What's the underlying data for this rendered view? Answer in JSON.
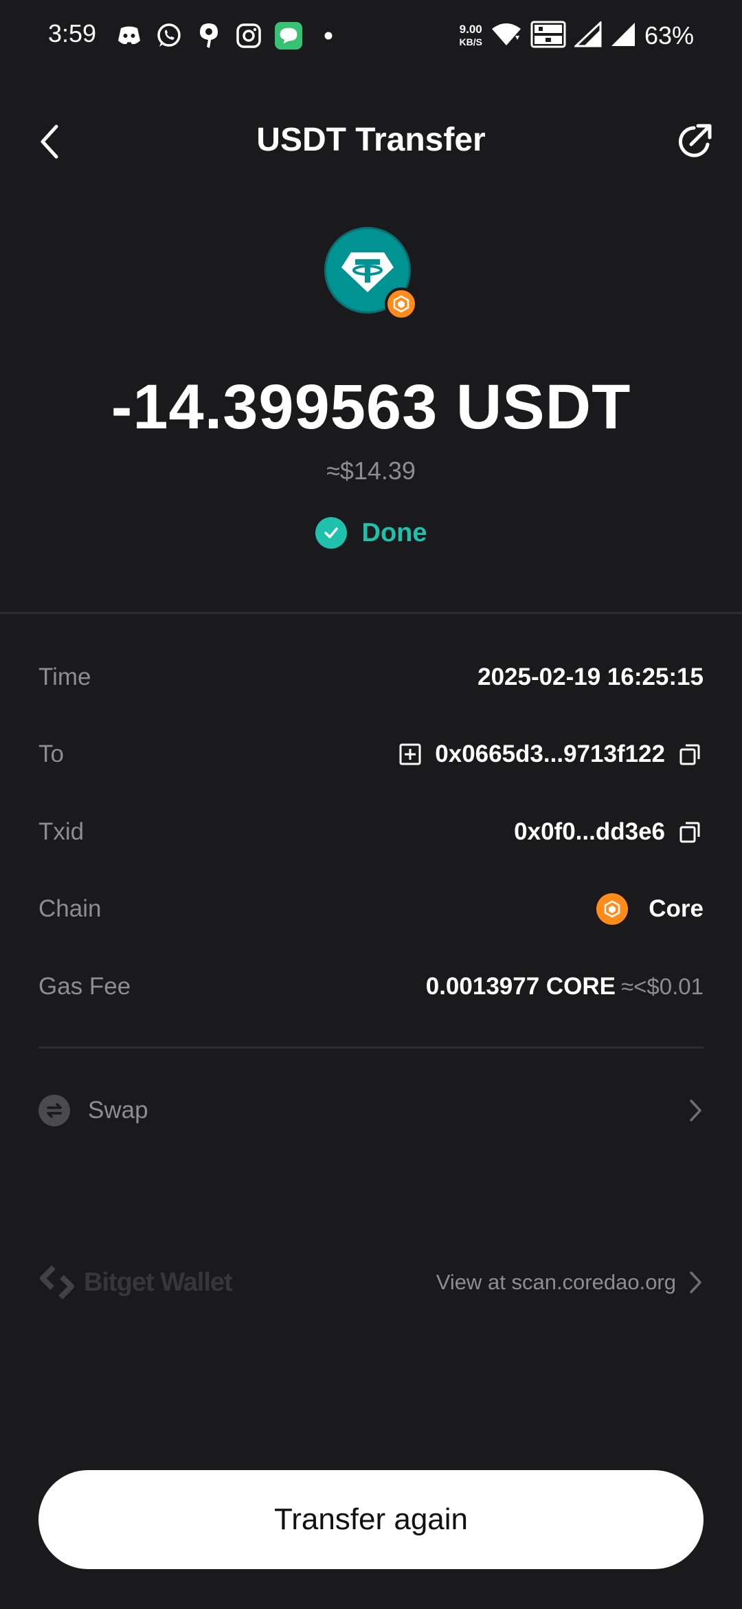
{
  "status_bar": {
    "time": "3:59",
    "net_speed": "9.00",
    "net_unit": "KB/S",
    "battery": "63%"
  },
  "header": {
    "title": "USDT Transfer"
  },
  "transfer": {
    "amount": "-14.399563 USDT",
    "amount_usd": "≈$14.39",
    "status": "Done"
  },
  "details": {
    "time_label": "Time",
    "time_value": "2025-02-19 16:25:15",
    "to_label": "To",
    "to_value": "0x0665d3...9713f122",
    "txid_label": "Txid",
    "txid_value": "0x0f0...dd3e6",
    "chain_label": "Chain",
    "chain_value": "Core",
    "gas_label": "Gas Fee",
    "gas_value": "0.0013977 CORE",
    "gas_usd": "≈<$0.01"
  },
  "swap": {
    "label": "Swap"
  },
  "footer": {
    "brand": "Bitget Wallet",
    "scan_link": "View at scan.coredao.org"
  },
  "cta": {
    "label": "Transfer again"
  },
  "colors": {
    "background": "#1a1a1c",
    "success": "#1fc1ad",
    "usdt": "#009393",
    "core": "#ff8c1a"
  }
}
